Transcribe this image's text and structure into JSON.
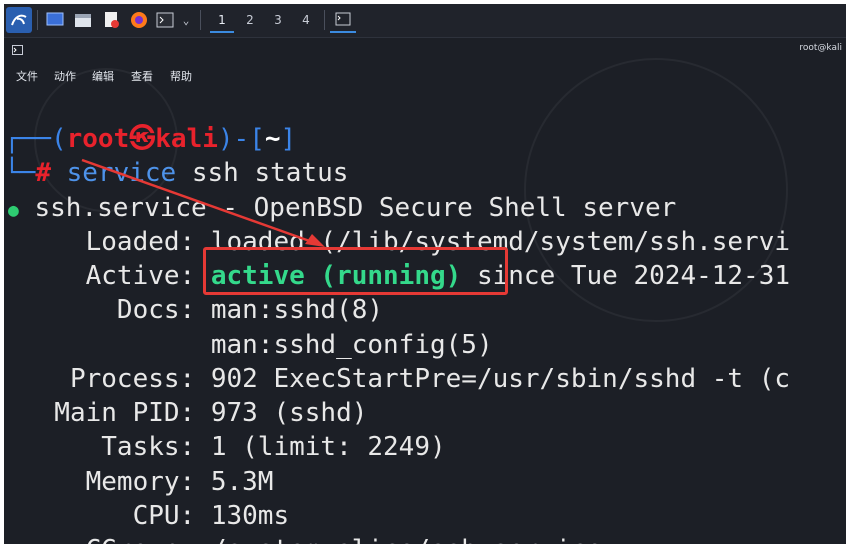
{
  "taskbar": {
    "workspaces": [
      "1",
      "2",
      "3",
      "4"
    ],
    "active_workspace": "1"
  },
  "window": {
    "title": "root@kali"
  },
  "menu": [
    "文件",
    "动作",
    "编辑",
    "查看",
    "帮助"
  ],
  "terminal": {
    "prompt": {
      "open": "┌──(",
      "user": "root",
      "at_symbol": "㉿",
      "host": "kali",
      "mid": ")-[",
      "path": "~",
      "close": "]",
      "hash_prefix": "└─",
      "hash": "#"
    },
    "command": {
      "cmd": "service",
      "args": " ssh status"
    },
    "output": {
      "bullet": "●",
      "service_line": " ssh.service - OpenBSD Secure Shell server",
      "loaded_label": "    Loaded:",
      "loaded_value": " loaded (/lib/systemd/system/ssh.servi",
      "active_label": "    Active:",
      "active_status": "active (running)",
      "active_since": " since Tue 2024-12-31",
      "docs_label": "      Docs:",
      "docs_1": " man:sshd(8)",
      "docs_2": "            man:sshd_config(5)",
      "process_line": "   Process: 902 ExecStartPre=/usr/sbin/sshd -t (c",
      "mainpid_line": "  Main PID: 973 (sshd)",
      "tasks_line": "     Tasks: 1 (limit: 2249)",
      "memory_line": "    Memory: 5.3M",
      "cpu_line": "       CPU: 130ms",
      "cgroup_line": "    CGroup: /system.slice/ssh.service"
    }
  },
  "colors": {
    "annotation": "#e53935",
    "active_status": "#34d98b",
    "prompt_user": "#e8222c",
    "prompt_frame": "#3b84e8"
  }
}
